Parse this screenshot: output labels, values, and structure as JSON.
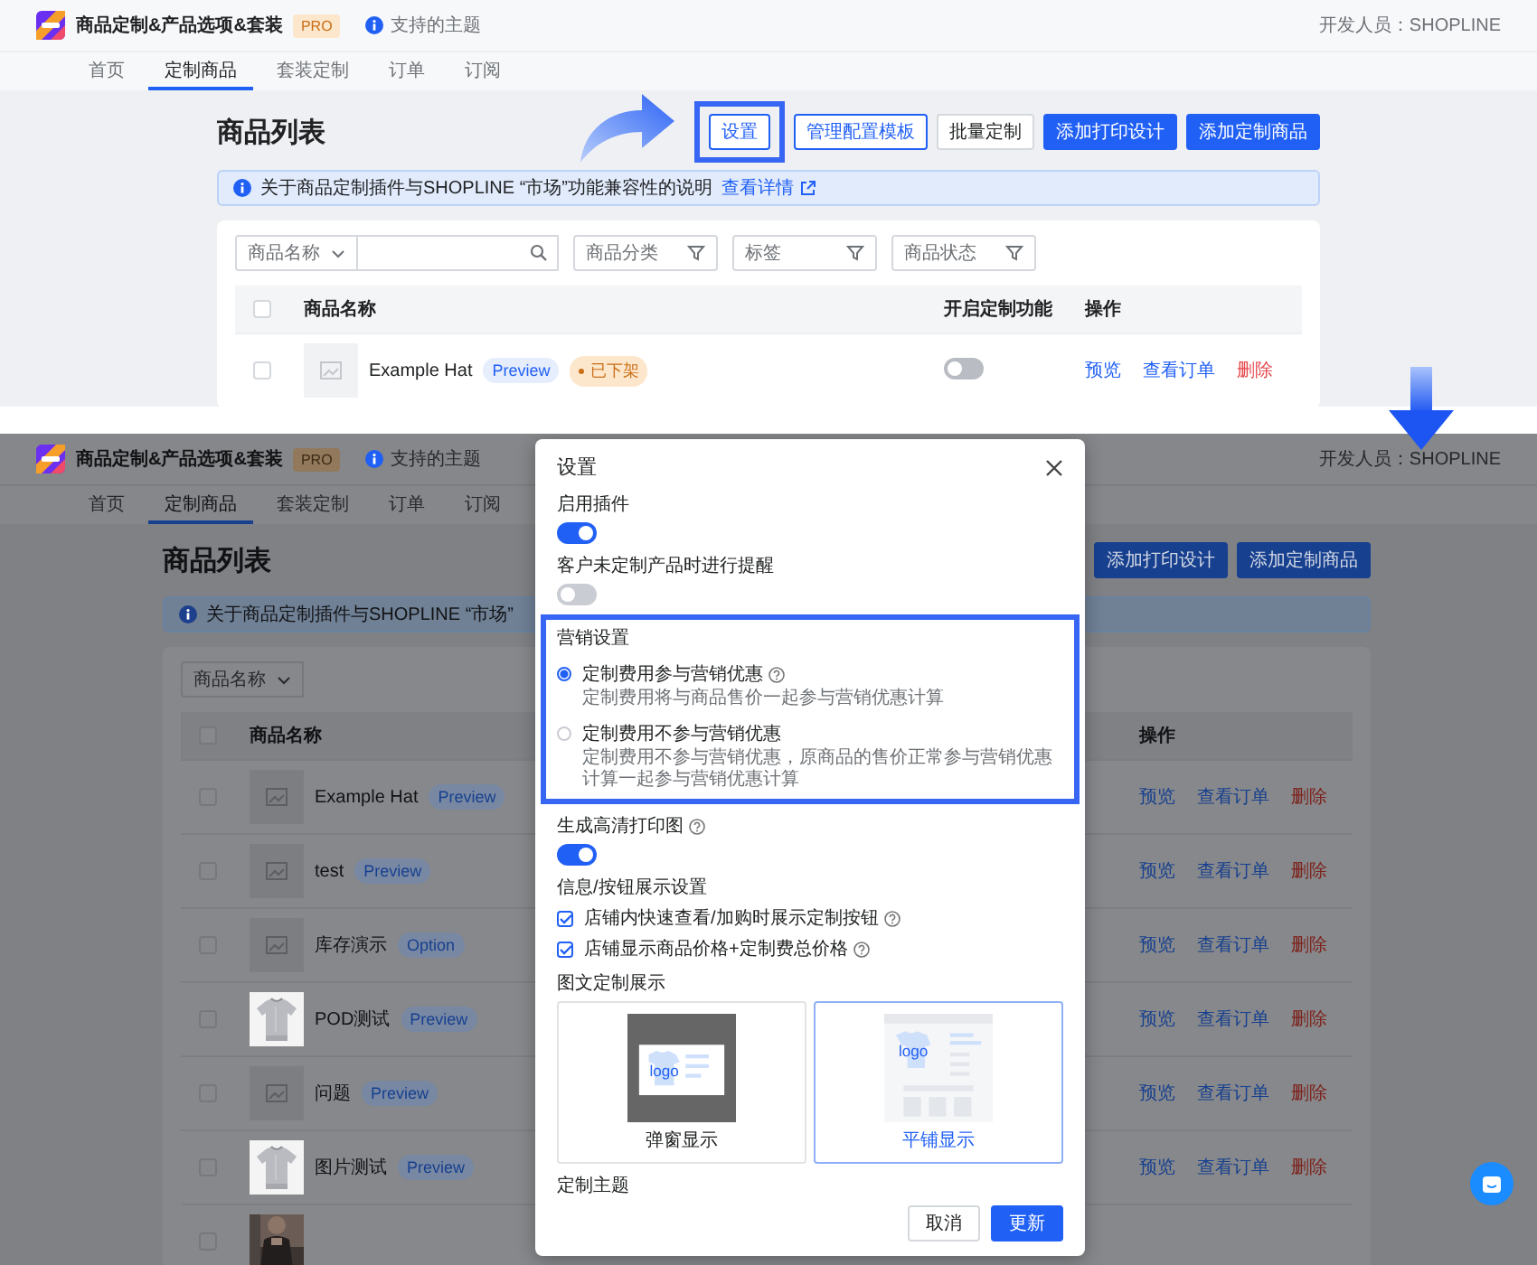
{
  "top_screen": {
    "app_bar": {
      "app_name": "商品定制&产品选项&套装",
      "plan_badge": "PRO",
      "themes_link": "支持的主题",
      "developer": "开发人员：SHOPLINE"
    },
    "tabs": [
      {
        "label": "首页",
        "selected": false
      },
      {
        "label": "定制商品",
        "selected": true
      },
      {
        "label": "套装定制",
        "selected": false
      },
      {
        "label": "订单",
        "selected": false
      },
      {
        "label": "订阅",
        "selected": false
      }
    ],
    "page_title": "商品列表",
    "buttons": [
      {
        "label": "设置",
        "kind": "outline",
        "highlighted": true
      },
      {
        "label": "管理配置模板",
        "kind": "outline",
        "highlighted": false
      },
      {
        "label": "批量定制",
        "kind": "default",
        "highlighted": false
      },
      {
        "label": "添加打印设计",
        "kind": "primary",
        "highlighted": false
      },
      {
        "label": "添加定制商品",
        "kind": "primary",
        "highlighted": false
      }
    ],
    "notice": {
      "text": "关于商品定制插件与SHOPLINE “市场”功能兼容性的说明",
      "link": "查看详情"
    },
    "filters": [
      {
        "kind": "select",
        "label": "商品名称"
      },
      {
        "kind": "search"
      },
      {
        "kind": "filter",
        "label": "商品分类"
      },
      {
        "kind": "filter",
        "label": "标签"
      },
      {
        "kind": "filter",
        "label": "商品状态"
      }
    ],
    "table": {
      "select_all_checked": false,
      "columns": [
        "商品名称",
        "开启定制功能",
        "操作"
      ],
      "rows": [
        {
          "checked": false,
          "thumbnail": {
            "kind": "placeholder"
          },
          "name": "Example Hat",
          "tags": [
            {
              "label": "Preview",
              "kind": "info"
            },
            {
              "label": "已下架",
              "kind": "warning"
            }
          ],
          "enabled": false,
          "actions": [
            {
              "label": "预览",
              "kind": "link"
            },
            {
              "label": "查看订单",
              "kind": "link"
            },
            {
              "label": "删除",
              "kind": "danger"
            }
          ]
        }
      ]
    }
  },
  "bottom_screen": {
    "app_bar": {
      "app_name": "商品定制&产品选项&套装",
      "plan_badge": "PRO",
      "themes_link": "支持的主题",
      "developer": "开发人员：SHOPLINE"
    },
    "tabs": [
      {
        "label": "首页",
        "selected": false
      },
      {
        "label": "定制商品",
        "selected": true
      },
      {
        "label": "套装定制",
        "selected": false
      },
      {
        "label": "订单",
        "selected": false
      },
      {
        "label": "订阅",
        "selected": false
      }
    ],
    "page_title": "商品列表",
    "buttons": [
      {
        "label": "添加打印设计",
        "kind": "primary",
        "highlighted": false
      },
      {
        "label": "添加定制商品",
        "kind": "primary",
        "highlighted": false
      }
    ],
    "notice": {
      "text": "关于商品定制插件与SHOPLINE “市场”"
    },
    "filters": [
      {
        "kind": "select",
        "label": "商品名称"
      }
    ],
    "table": {
      "select_all_checked": false,
      "columns": [
        "商品名称",
        "操作"
      ],
      "rows": [
        {
          "checked": false,
          "thumbnail": {
            "kind": "placeholder"
          },
          "name": "Example Hat",
          "tags": [
            {
              "label": "Preview",
              "kind": "info"
            }
          ],
          "actions": [
            {
              "label": "预览",
              "kind": "link"
            },
            {
              "label": "查看订单",
              "kind": "link"
            },
            {
              "label": "删除",
              "kind": "danger"
            }
          ]
        },
        {
          "checked": false,
          "thumbnail": {
            "kind": "placeholder"
          },
          "name": "test",
          "tags": [
            {
              "label": "Preview",
              "kind": "info"
            }
          ],
          "actions": [
            {
              "label": "预览",
              "kind": "link"
            },
            {
              "label": "查看订单",
              "kind": "link"
            },
            {
              "label": "删除",
              "kind": "danger"
            }
          ]
        },
        {
          "checked": false,
          "thumbnail": {
            "kind": "placeholder"
          },
          "name": "库存演示",
          "tags": [
            {
              "label": "Option",
              "kind": "info"
            }
          ],
          "actions": [
            {
              "label": "预览",
              "kind": "link"
            },
            {
              "label": "查看订单",
              "kind": "link"
            },
            {
              "label": "删除",
              "kind": "danger"
            }
          ]
        },
        {
          "checked": false,
          "thumbnail": {
            "kind": "product_photo"
          },
          "name": "POD测试",
          "tags": [
            {
              "label": "Preview",
              "kind": "info"
            }
          ],
          "actions": [
            {
              "label": "预览",
              "kind": "link"
            },
            {
              "label": "查看订单",
              "kind": "link"
            },
            {
              "label": "删除",
              "kind": "danger"
            }
          ]
        },
        {
          "checked": false,
          "thumbnail": {
            "kind": "placeholder"
          },
          "name": "问题",
          "tags": [
            {
              "label": "Preview",
              "kind": "info"
            }
          ],
          "actions": [
            {
              "label": "预览",
              "kind": "link"
            },
            {
              "label": "查看订单",
              "kind": "link"
            },
            {
              "label": "删除",
              "kind": "danger"
            }
          ]
        },
        {
          "checked": false,
          "thumbnail": {
            "kind": "product_photo"
          },
          "name": "图片测试",
          "tags": [
            {
              "label": "Preview",
              "kind": "info"
            }
          ],
          "actions": [
            {
              "label": "预览",
              "kind": "link"
            },
            {
              "label": "查看订单",
              "kind": "link"
            },
            {
              "label": "删除",
              "kind": "danger"
            }
          ]
        },
        {
          "checked": false,
          "thumbnail": {
            "kind": "model_photo"
          }
        }
      ]
    }
  },
  "dialog": {
    "title": "设置",
    "settings": [
      {
        "kind": "switch",
        "label": "启用插件",
        "help": false,
        "on": true
      },
      {
        "kind": "switch",
        "label": "客户未定制产品时进行提醒",
        "help": false,
        "on": false
      },
      {
        "kind": "radio_group",
        "label": "营销设置",
        "highlighted": true,
        "options": [
          {
            "label": "定制费用参与营销优惠",
            "help": true,
            "description": "定制费用将与商品售价一起参与营销优惠计算",
            "selected": true
          },
          {
            "label": "定制费用不参与营销优惠",
            "help": false,
            "description": "定制费用不参与营销优惠，原商品的售价正常参与营销优惠计算一起参与营销优惠计算",
            "selected": false
          }
        ]
      },
      {
        "kind": "switch",
        "label": "生成高清打印图",
        "help": true,
        "on": true
      },
      {
        "kind": "checkbox_group",
        "label": "信息/按钮展示设置",
        "options": [
          {
            "label": "店铺内快速查看/加购时展示定制按钮",
            "help": true,
            "checked": true
          },
          {
            "label": "店铺显示商品价格+定制费总价格",
            "help": true,
            "checked": true
          }
        ]
      },
      {
        "kind": "display_cards",
        "label": "图文定制展示",
        "options": [
          {
            "label": "弹窗显示",
            "kind": "popup",
            "mock_text": "logo",
            "selected": false
          },
          {
            "label": "平铺显示",
            "kind": "tiled",
            "mock_text": "logo",
            "selected": true
          }
        ]
      },
      {
        "kind": "heading",
        "label": "定制主题"
      }
    ],
    "buttons": [
      {
        "label": "取消",
        "kind": "default"
      },
      {
        "label": "更新",
        "kind": "primary"
      }
    ]
  }
}
